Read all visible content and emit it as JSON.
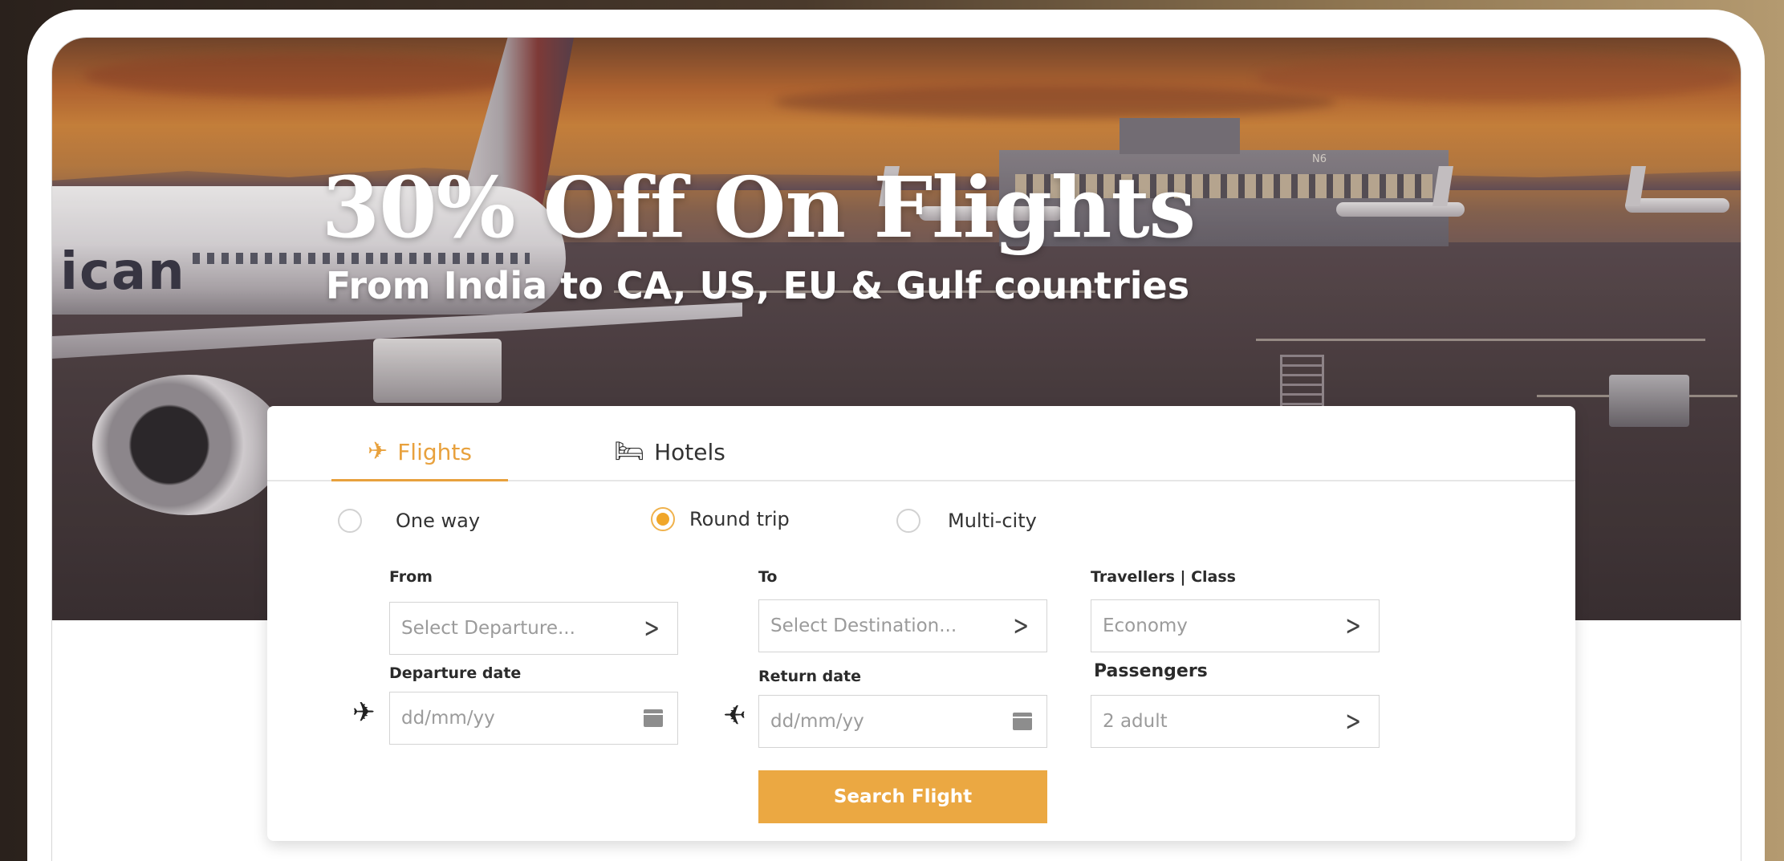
{
  "hero": {
    "title": "30% Off On Flights",
    "subtitle": "From India to CA, US, EU & Gulf countries",
    "plane_logo": "ican"
  },
  "tabs": [
    {
      "label": "Flights",
      "icon": "airplane-icon",
      "active": true
    },
    {
      "label": "Hotels",
      "icon": "bed-icon",
      "active": false
    }
  ],
  "trip_types": [
    {
      "label": "One way",
      "checked": false
    },
    {
      "label": "Round trip",
      "checked": true
    },
    {
      "label": "Multi-city",
      "checked": false
    }
  ],
  "form": {
    "from": {
      "label": "From",
      "placeholder": "Select Departure..."
    },
    "to": {
      "label": "To",
      "placeholder": "Select Destination..."
    },
    "travellers_class": {
      "label": "Travellers | Class",
      "value": "Economy"
    },
    "departure_date": {
      "label": "Departure date",
      "placeholder": "dd/mm/yy"
    },
    "return_date": {
      "label": "Return date",
      "placeholder": "dd/mm/yy"
    },
    "passengers": {
      "label": "Passengers",
      "value": "2 adult"
    },
    "search_button": "Search Flight"
  },
  "colors": {
    "accent": "#eba842",
    "active_tab": "#e8a13d"
  }
}
